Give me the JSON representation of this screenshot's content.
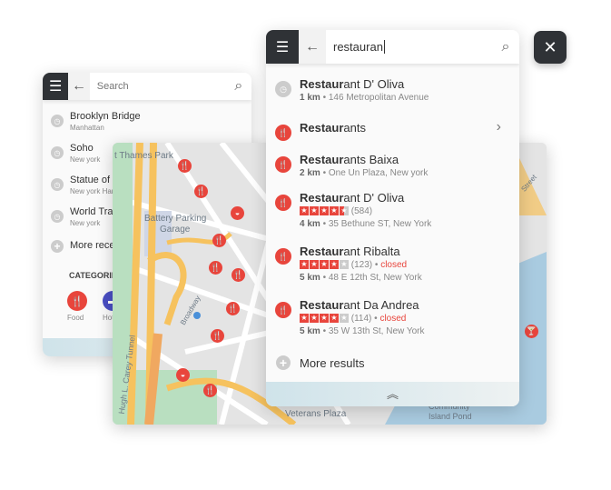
{
  "back_panel": {
    "search_placeholder": "Search",
    "recents": [
      {
        "name": "Brooklyn Bridge",
        "sub": "Manhattan"
      },
      {
        "name": "Soho",
        "sub": "New york"
      },
      {
        "name": "Statue of Liberty",
        "sub": "New york Harbor"
      },
      {
        "name": "World Trade Center",
        "sub": "New york"
      }
    ],
    "more_recents": "More recents",
    "categories_title": "CATEGORIES",
    "categories": [
      {
        "label": "Food",
        "color": "#e8453c",
        "icon": "fork-knife-icon"
      },
      {
        "label": "Hotels",
        "color": "#4a4fc4",
        "icon": "bed-icon"
      }
    ]
  },
  "map": {
    "labels": [
      "t Thames Park",
      "Battery Parking",
      "Garage",
      "Broadway",
      "Hugh L. Carey Tunnel",
      "Veterans Plaza",
      "Community",
      "Island Pond",
      "Street"
    ],
    "colors": {
      "road": "#f6c25e",
      "park": "#b9dfc0",
      "water": "#a9cbe0",
      "bg": "#e4e4e4"
    }
  },
  "front_panel": {
    "query": "restauran",
    "results": [
      {
        "match": "Restaur",
        "rest": "ant D' Oliva",
        "dist": "1 km",
        "address": "146 Metropolitan Avenue",
        "icon": "history-icon"
      },
      {
        "match": "Restaur",
        "rest": "ants",
        "icon": "fork-knife-icon",
        "chevron": true
      },
      {
        "match": "Restaur",
        "rest": "ants Baixa",
        "dist": "2 km",
        "address": "One Un Plaza, New york",
        "icon": "fork-knife-icon"
      },
      {
        "match": "Restaur",
        "rest": "ant D' Oliva",
        "dist": "4 km",
        "address": "35 Bethune ST, New York",
        "rating": 4.5,
        "reviews": "(584)",
        "icon": "fork-knife-icon"
      },
      {
        "match": "Restaur",
        "rest": "ant Ribalta",
        "dist": "5 km",
        "address": "48 E 12th St, New York",
        "rating": 4,
        "reviews": "(123)",
        "status": "closed",
        "icon": "fork-knife-icon"
      },
      {
        "match": "Restaur",
        "rest": "ant Da Andrea",
        "dist": "5 km",
        "address": "35 W 13th St, New York",
        "rating": 4,
        "reviews": "(114)",
        "status": "closed",
        "icon": "fork-knife-icon"
      }
    ],
    "more_results": "More results",
    "accent": "#e8453c"
  }
}
